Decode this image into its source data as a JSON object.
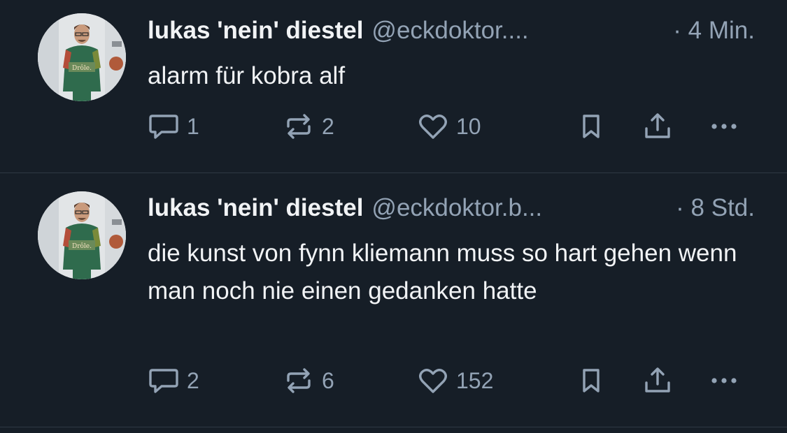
{
  "posts": [
    {
      "author_name": "lukas 'nein' diestel",
      "author_handle": "@eckdoktor....",
      "time": "· 4 Min.",
      "text": "alarm für kobra alf",
      "replies": "1",
      "reposts": "2",
      "likes": "10",
      "avatar_icon": "avatar-photo"
    },
    {
      "author_name": "lukas 'nein' diestel",
      "author_handle": "@eckdoktor.b...",
      "time": "· 8 Std.",
      "text": "die kunst von fynn kliemann muss so hart gehen wenn man noch nie einen gedanken hatte",
      "replies": "2",
      "reposts": "6",
      "likes": "152",
      "avatar_icon": "avatar-photo"
    }
  ],
  "icons": {
    "reply": "reply-icon",
    "repost": "repost-icon",
    "like": "heart-icon",
    "bookmark": "bookmark-icon",
    "share": "share-icon",
    "more": "more-icon"
  },
  "colors": {
    "background": "#161e27",
    "text": "#f1f3f5",
    "muted": "#93a3b5",
    "divider": "#2e3944"
  }
}
